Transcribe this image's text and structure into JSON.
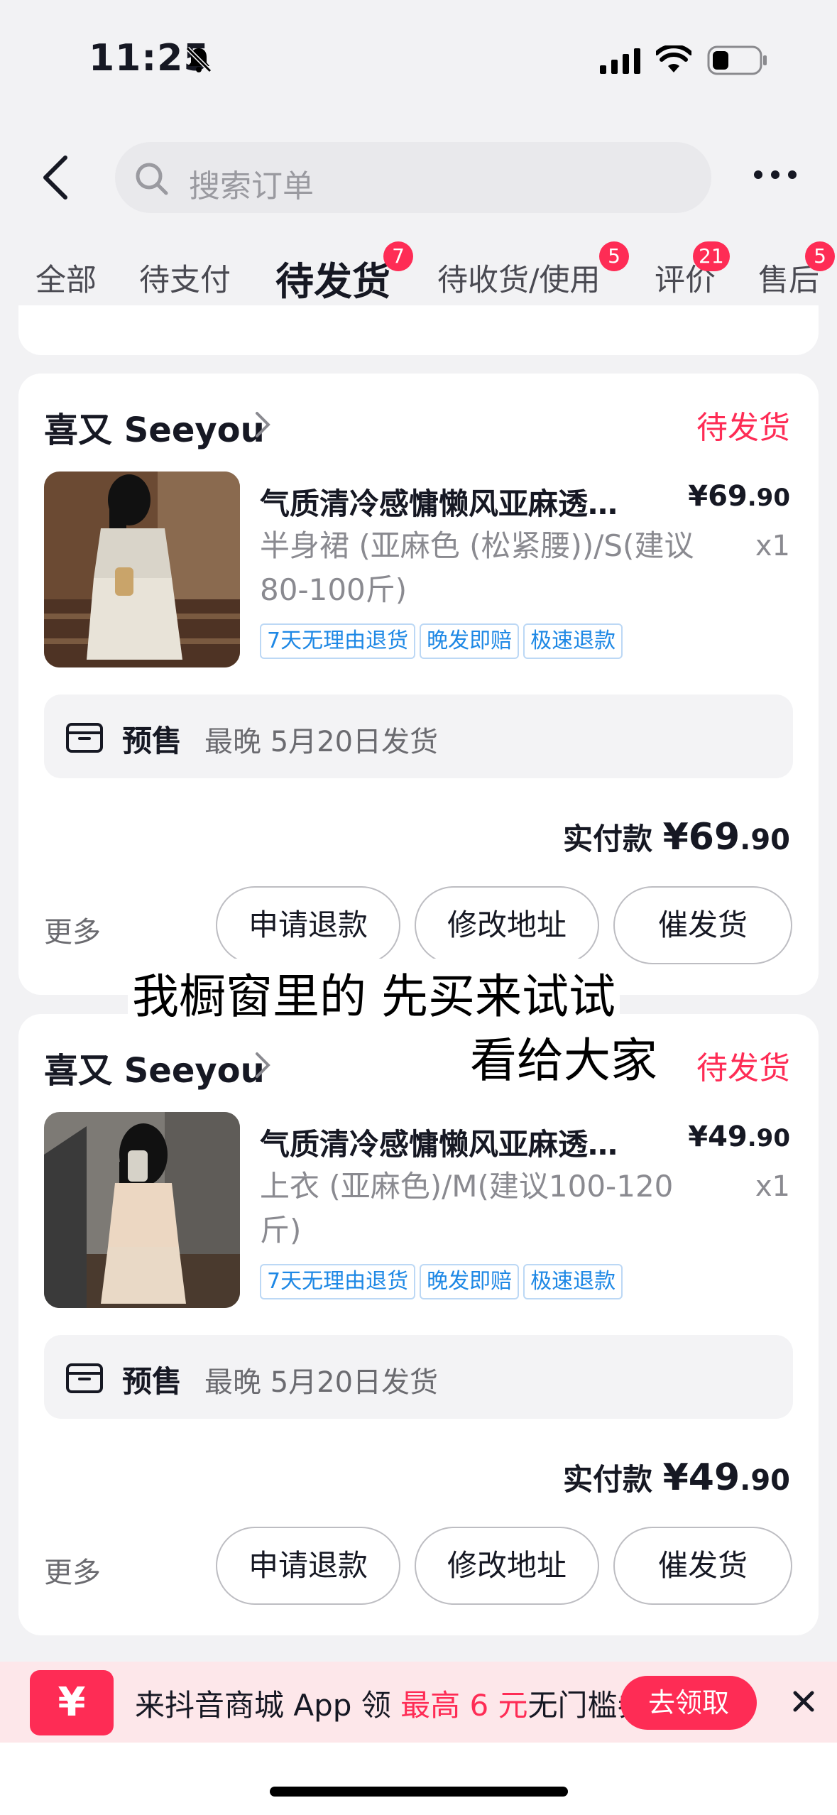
{
  "status_bar": {
    "time": "11:25"
  },
  "search": {
    "placeholder": "搜索订单"
  },
  "tabs": [
    {
      "label": "全部",
      "badge": ""
    },
    {
      "label": "待支付",
      "badge": ""
    },
    {
      "label": "待发货",
      "badge": "7"
    },
    {
      "label": "待收货/使用",
      "badge": "5"
    },
    {
      "label": "评价",
      "badge": "21"
    },
    {
      "label": "售后",
      "badge": "5"
    }
  ],
  "orders": [
    {
      "shop": "喜又 Seeyou",
      "status": "待发货",
      "title": "气质清冷感慵懒风亚麻透…",
      "price_int": "¥69",
      "price_dec": ".90",
      "spec": "半身裙 (亚麻色 (松紧腰))/S(建议80-100斤)",
      "qty": "x1",
      "tags": [
        "7天无理由退货",
        "晚发即赔",
        "极速退款"
      ],
      "presale_label": "预售",
      "presale_text": "最晚 5月20日发货",
      "paid_label": "实付款 ",
      "paid_int": "¥69",
      "paid_dec": ".90",
      "more": "更多",
      "buttons": [
        "申请退款",
        "修改地址",
        "催发货"
      ]
    },
    {
      "shop": "喜又 Seeyou",
      "status": "待发货",
      "title": "气质清冷感慵懒风亚麻透…",
      "price_int": "¥49",
      "price_dec": ".90",
      "spec": "上衣 (亚麻色)/M(建议100-120斤)",
      "qty": "x1",
      "tags": [
        "7天无理由退货",
        "晚发即赔",
        "极速退款"
      ],
      "presale_label": "预售",
      "presale_text": "最晚 5月20日发货",
      "paid_label": "实付款 ",
      "paid_int": "¥49",
      "paid_dec": ".90",
      "more": "更多",
      "buttons": [
        "申请退款",
        "修改地址",
        "催发货"
      ]
    }
  ],
  "overlay": {
    "line1": "我橱窗里的 先买来试试",
    "line2": "看给大家"
  },
  "promo": {
    "icon": "¥",
    "prefix": "来抖音商城 App 领 ",
    "highlight": "最高 6 元",
    "suffix": "无门槛券",
    "button": "去领取"
  },
  "colors": {
    "accent": "#fe2c55",
    "tag_blue": "#1e88e5"
  }
}
